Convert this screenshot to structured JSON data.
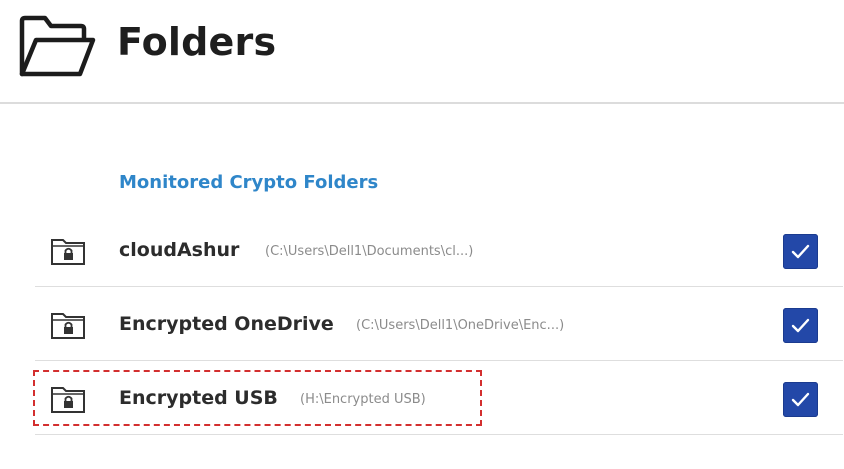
{
  "header": {
    "title": "Folders",
    "icon": "folder-open-icon"
  },
  "section": {
    "title": "Monitored Crypto Folders"
  },
  "folders": [
    {
      "name": "cloudAshur",
      "path": "(C:\\Users\\Dell1\\Documents\\cl...)",
      "icon": "lock-folder-icon",
      "checked": true
    },
    {
      "name": "Encrypted OneDrive",
      "path": "(C:\\Users\\Dell1\\OneDrive\\Enc...)",
      "icon": "lock-folder-icon",
      "checked": true
    },
    {
      "name": "Encrypted USB",
      "path": "(H:\\Encrypted USB)",
      "icon": "lock-folder-icon",
      "checked": true,
      "highlighted": true
    }
  ],
  "colors": {
    "accent": "#2f86c9",
    "checkbox": "#2348a8",
    "highlight": "#d32f2f"
  }
}
